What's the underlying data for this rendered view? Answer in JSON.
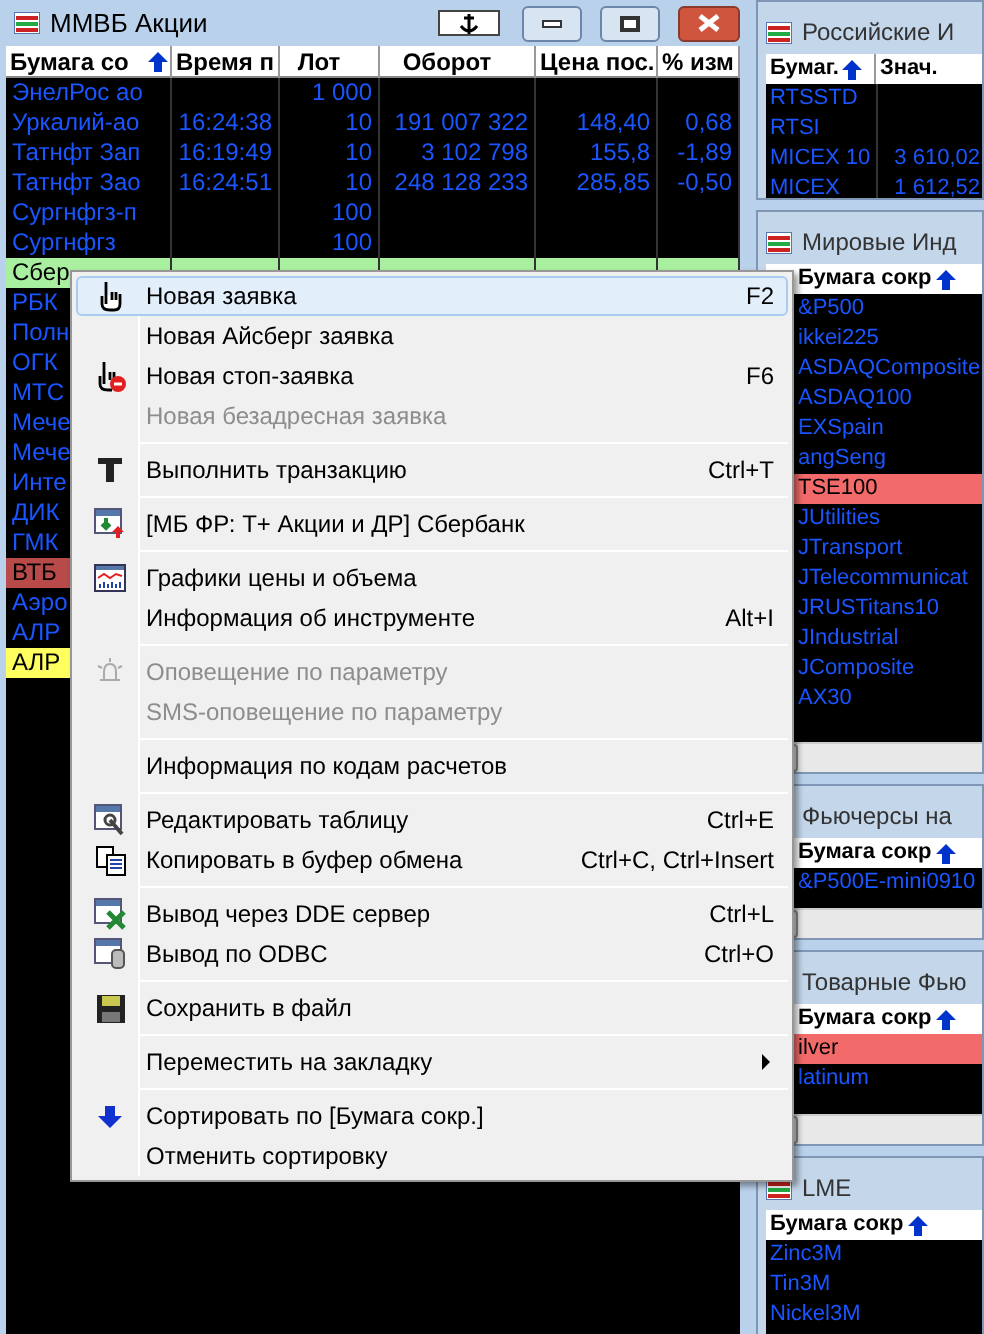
{
  "main_window": {
    "title": "ММВБ Акции",
    "columns": [
      {
        "label": "Бумага со",
        "sorted": true
      },
      {
        "label": "Время п",
        "sorted": false
      },
      {
        "label": "Лот",
        "sorted": false
      },
      {
        "label": "Оборот",
        "sorted": false
      },
      {
        "label": "Цена пос.",
        "sorted": false
      },
      {
        "label": "% изм",
        "sorted": false
      }
    ],
    "rows": [
      {
        "cells": [
          "ЭнелРос ао",
          "",
          "1 000",
          "",
          "",
          ""
        ]
      },
      {
        "cells": [
          "Уркалий-ао",
          "16:24:38",
          "10",
          "191 007 322",
          "148,40",
          "0,68"
        ]
      },
      {
        "cells": [
          "Татнфт Зап",
          "16:19:49",
          "10",
          "3 102 798",
          "155,8",
          "-1,89"
        ]
      },
      {
        "cells": [
          "Татнфт Зао",
          "16:24:51",
          "10",
          "248 128 233",
          "285,85",
          "-0,50"
        ]
      },
      {
        "cells": [
          "Сургнфгз-п",
          "",
          "100",
          "",
          "",
          ""
        ]
      },
      {
        "cells": [
          "Сургнфгз",
          "",
          "100",
          "",
          "",
          ""
        ]
      },
      {
        "cells": [
          "Сбер"
        ],
        "color": "#a8f0a0"
      },
      {
        "cells": [
          "РБК"
        ]
      },
      {
        "cells": [
          "Полн"
        ]
      },
      {
        "cells": [
          "ОГК"
        ]
      },
      {
        "cells": [
          "МТС"
        ]
      },
      {
        "cells": [
          "Мече"
        ]
      },
      {
        "cells": [
          "Мече"
        ]
      },
      {
        "cells": [
          "Инте"
        ]
      },
      {
        "cells": [
          "ДИК"
        ]
      },
      {
        "cells": [
          "ГМК"
        ]
      },
      {
        "cells": [
          "ВТБ"
        ],
        "color": "#b84a4a"
      },
      {
        "cells": [
          "Аэро"
        ]
      },
      {
        "cells": [
          "АЛР"
        ]
      },
      {
        "cells": [
          "АЛР"
        ],
        "color": "#ffff60"
      }
    ]
  },
  "side_windows": [
    {
      "title": "Российские И",
      "columns": [
        {
          "label": "Бумаг.",
          "sorted": true
        },
        {
          "label": "Знач.",
          "sorted": false
        }
      ],
      "rows": [
        {
          "cells": [
            "RTSSTD",
            ""
          ]
        },
        {
          "cells": [
            "RTSI",
            ""
          ]
        },
        {
          "cells": [
            "MICEX 10",
            "3 610,02"
          ]
        },
        {
          "cells": [
            "MICEX",
            "1 612,52"
          ]
        }
      ],
      "scrollbar": false
    },
    {
      "title": "Мировые Инд",
      "columns": [
        {
          "label": "Бумага сокр",
          "sorted": true
        }
      ],
      "rows": [
        {
          "cells": [
            "&P500"
          ]
        },
        {
          "cells": [
            "ikkei225"
          ]
        },
        {
          "cells": [
            "ASDAQComposite"
          ]
        },
        {
          "cells": [
            "ASDAQ100"
          ]
        },
        {
          "cells": [
            "EXSpain"
          ]
        },
        {
          "cells": [
            "angSeng"
          ]
        },
        {
          "cells": [
            "TSE100"
          ],
          "color": "#f26a6a"
        },
        {
          "cells": [
            "JUtilities"
          ]
        },
        {
          "cells": [
            "JTransport"
          ]
        },
        {
          "cells": [
            "JTelecommunicat"
          ]
        },
        {
          "cells": [
            "JRUSTitans10"
          ]
        },
        {
          "cells": [
            "JIndustrial"
          ]
        },
        {
          "cells": [
            "JComposite"
          ]
        },
        {
          "cells": [
            "AX30"
          ]
        }
      ],
      "scrollbar": true
    },
    {
      "title": "Фьючерсы на",
      "columns": [
        {
          "label": "Бумага сокр",
          "sorted": true
        }
      ],
      "rows": [
        {
          "cells": [
            "&P500E-mini0910"
          ]
        }
      ],
      "scrollbar": true
    },
    {
      "title": "Товарные Фью",
      "columns": [
        {
          "label": "Бумага сокр",
          "sorted": true
        }
      ],
      "rows": [
        {
          "cells": [
            "ilver"
          ],
          "color": "#f26a6a"
        },
        {
          "cells": [
            "latinum"
          ]
        }
      ],
      "scrollbar": true
    },
    {
      "title": "LME",
      "columns": [
        {
          "label": "Бумага сокр",
          "sorted": true
        }
      ],
      "rows": [
        {
          "cells": [
            "Zinc3M"
          ]
        },
        {
          "cells": [
            "Tin3M"
          ]
        },
        {
          "cells": [
            "Nickel3M"
          ]
        }
      ],
      "scrollbar": false
    }
  ],
  "context_menu": {
    "items": [
      {
        "kind": "item",
        "label": "Новая заявка",
        "shortcut": "F2",
        "selected": true,
        "disabled": false
      },
      {
        "kind": "item",
        "label": "Новая Айсберг заявка",
        "selected": false,
        "disabled": false
      },
      {
        "kind": "item",
        "label": "Новая стоп-заявка",
        "shortcut": "F6",
        "selected": false,
        "disabled": false
      },
      {
        "kind": "item",
        "label": "Новая безадресная заявка",
        "selected": false,
        "disabled": true
      },
      {
        "kind": "separator"
      },
      {
        "kind": "item",
        "label": "Выполнить транзакцию",
        "shortcut": "Ctrl+T",
        "selected": false,
        "disabled": false
      },
      {
        "kind": "separator"
      },
      {
        "kind": "item",
        "label": "[МБ ФР: Т+ Акции и ДР] Сбербанк",
        "selected": false,
        "disabled": false
      },
      {
        "kind": "separator"
      },
      {
        "kind": "item",
        "label": "Графики цены и объема",
        "selected": false,
        "disabled": false
      },
      {
        "kind": "item",
        "label": "Информация об инструменте",
        "shortcut": "Alt+I",
        "selected": false,
        "disabled": false
      },
      {
        "kind": "separator"
      },
      {
        "kind": "item",
        "label": "Оповещение по параметру",
        "selected": false,
        "disabled": true
      },
      {
        "kind": "item",
        "label": "SMS-оповещение по параметру",
        "selected": false,
        "disabled": true
      },
      {
        "kind": "separator"
      },
      {
        "kind": "item",
        "label": "Информация по кодам расчетов",
        "selected": false,
        "disabled": false
      },
      {
        "kind": "separator"
      },
      {
        "kind": "item",
        "label": "Редактировать таблицу",
        "shortcut": "Ctrl+E",
        "selected": false,
        "disabled": false
      },
      {
        "kind": "item",
        "label": "Копировать в буфер обмена",
        "shortcut": "Ctrl+C, Ctrl+Insert",
        "selected": false,
        "disabled": false
      },
      {
        "kind": "separator"
      },
      {
        "kind": "item",
        "label": "Вывод через DDE сервер",
        "shortcut": "Ctrl+L",
        "selected": false,
        "disabled": false
      },
      {
        "kind": "item",
        "label": "Вывод по ODBC",
        "shortcut": "Ctrl+O",
        "selected": false,
        "disabled": false
      },
      {
        "kind": "separator"
      },
      {
        "kind": "item",
        "label": "Сохранить в файл",
        "selected": false,
        "disabled": false
      },
      {
        "kind": "separator"
      },
      {
        "kind": "item",
        "label": "Переместить на закладку",
        "selected": false,
        "disabled": false,
        "submenu": true
      },
      {
        "kind": "separator"
      },
      {
        "kind": "item",
        "label": "Сортировать по [Бумага сокр.]",
        "selected": false,
        "disabled": false
      },
      {
        "kind": "item",
        "label": "Отменить сортировку",
        "selected": false,
        "disabled": false
      }
    ]
  }
}
